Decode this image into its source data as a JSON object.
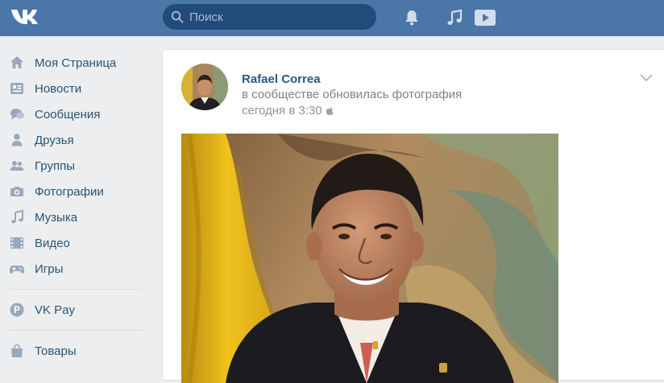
{
  "header": {
    "logo_text": "VK",
    "search_placeholder": "Поиск",
    "icons": [
      "bell-icon",
      "music-note-icon",
      "video-play-icon"
    ]
  },
  "sidebar": {
    "items": [
      {
        "label": "Моя Страница",
        "icon": "home-icon"
      },
      {
        "label": "Новости",
        "icon": "news-icon"
      },
      {
        "label": "Сообщения",
        "icon": "messages-icon"
      },
      {
        "label": "Друзья",
        "icon": "person-icon"
      },
      {
        "label": "Группы",
        "icon": "groups-icon"
      },
      {
        "label": "Фотографии",
        "icon": "camera-icon"
      },
      {
        "label": "Музыка",
        "icon": "music-icon"
      },
      {
        "label": "Видео",
        "icon": "video-icon"
      },
      {
        "label": "Игры",
        "icon": "gamepad-icon"
      }
    ],
    "pay": {
      "label": "VK Pay",
      "icon": "vkpay-icon",
      "icon_letter": "P"
    },
    "goods": {
      "label": "Товары",
      "icon": "bag-icon"
    }
  },
  "post": {
    "author": "Rafael Correa",
    "subtitle": "в сообществе обновилась фотография",
    "time": "сегодня в 3:30",
    "platform_icon": "apple-icon",
    "menu_icon": "chevron-down-icon",
    "photo_icon": "portrait-photo"
  },
  "colors": {
    "header": "#4a76a8",
    "background": "#edeef0",
    "link": "#2a5885",
    "nav_text": "#285473"
  }
}
